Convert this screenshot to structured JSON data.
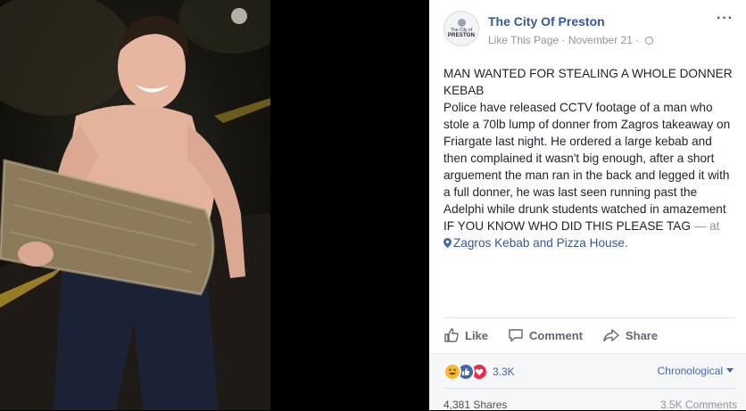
{
  "post": {
    "page_name": "The City Of Preston",
    "like_page": "Like This Page",
    "meta_sep": " · ",
    "date": "November 21",
    "more": "···",
    "avatar": {
      "line1": "The City of",
      "line2": "PRESTON"
    },
    "headline": "MAN WANTED FOR STEALING A WHOLE DONNER KEBAB",
    "body": "Police have released CCTV footage of a man who stole a 70lb lump of donner from Zagros takeaway on Friargate last night. He ordered a large kebab and then complained it wasn't big enough, after a short arguement the man ran in the back and legged it with a full donner, he was last seen running past the Adelphi while drunk students watched in amazement",
    "tag_line": "IF YOU KNOW WHO DID THIS PLEASE TAG",
    "at_text": "— at",
    "place": "Zagros Kebab and Pizza House."
  },
  "actions": {
    "like": "Like",
    "comment": "Comment",
    "share": "Share"
  },
  "footer": {
    "reaction_count": "3.3K",
    "sort_label": "Chronological",
    "shares": "4,381 Shares",
    "comments": "3.5K Comments"
  },
  "colors": {
    "link": "#365899",
    "accent": "#4267b2",
    "muted": "#90949c"
  },
  "icons": [
    "like-thumb-icon",
    "comment-bubble-icon",
    "share-arrow-icon",
    "globe-icon",
    "location-pin-icon",
    "haha-reaction-icon",
    "like-reaction-icon",
    "love-reaction-icon"
  ]
}
